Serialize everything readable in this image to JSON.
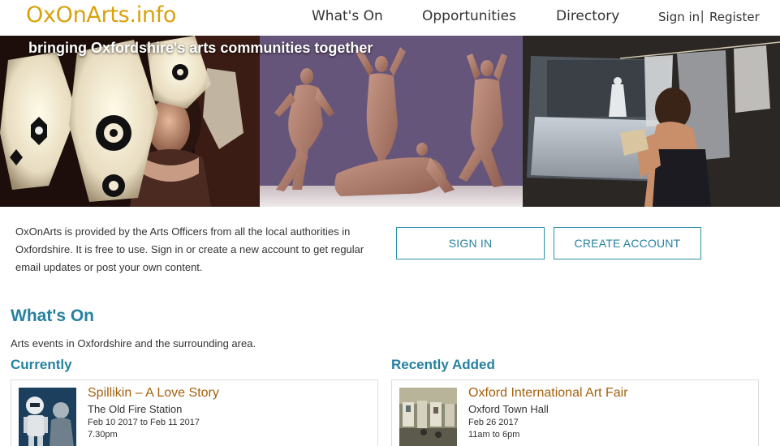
{
  "header": {
    "logo": "OxOnArts.info",
    "nav": {
      "whats_on": "What's On",
      "opportunities": "Opportunities",
      "directory": "Directory"
    },
    "sign_in": "Sign in",
    "separator": "|",
    "register": "Register"
  },
  "hero": {
    "tagline": "bringing Oxfordshire's arts communities together"
  },
  "intro": {
    "text": "OxOnArts is provided by the Arts Officers from all the local authorities in Oxfordshire. It is free to use. Sign in or create a new account to get regular email updates or post your own content.",
    "sign_in_button": "SIGN IN",
    "create_account_button": "CREATE ACCOUNT"
  },
  "whats_on": {
    "title": "What's On",
    "subtitle": "Arts events in Oxfordshire and the surrounding area.",
    "currently": {
      "title": "Currently",
      "event": {
        "title": "Spillikin – A Love Story",
        "venue": "The Old Fire Station",
        "dates": "Feb 10 2017 to Feb 11 2017",
        "time": "7.30pm"
      }
    },
    "recently_added": {
      "title": "Recently Added",
      "event": {
        "title": "Oxford International Art Fair",
        "venue": "Oxford Town Hall",
        "dates": "Feb 26 2017",
        "time": "11am to 6pm"
      }
    }
  },
  "colors": {
    "logo": "#d8a20b",
    "accent": "#2581a0",
    "event_title": "#a5600e",
    "text": "#333333"
  }
}
